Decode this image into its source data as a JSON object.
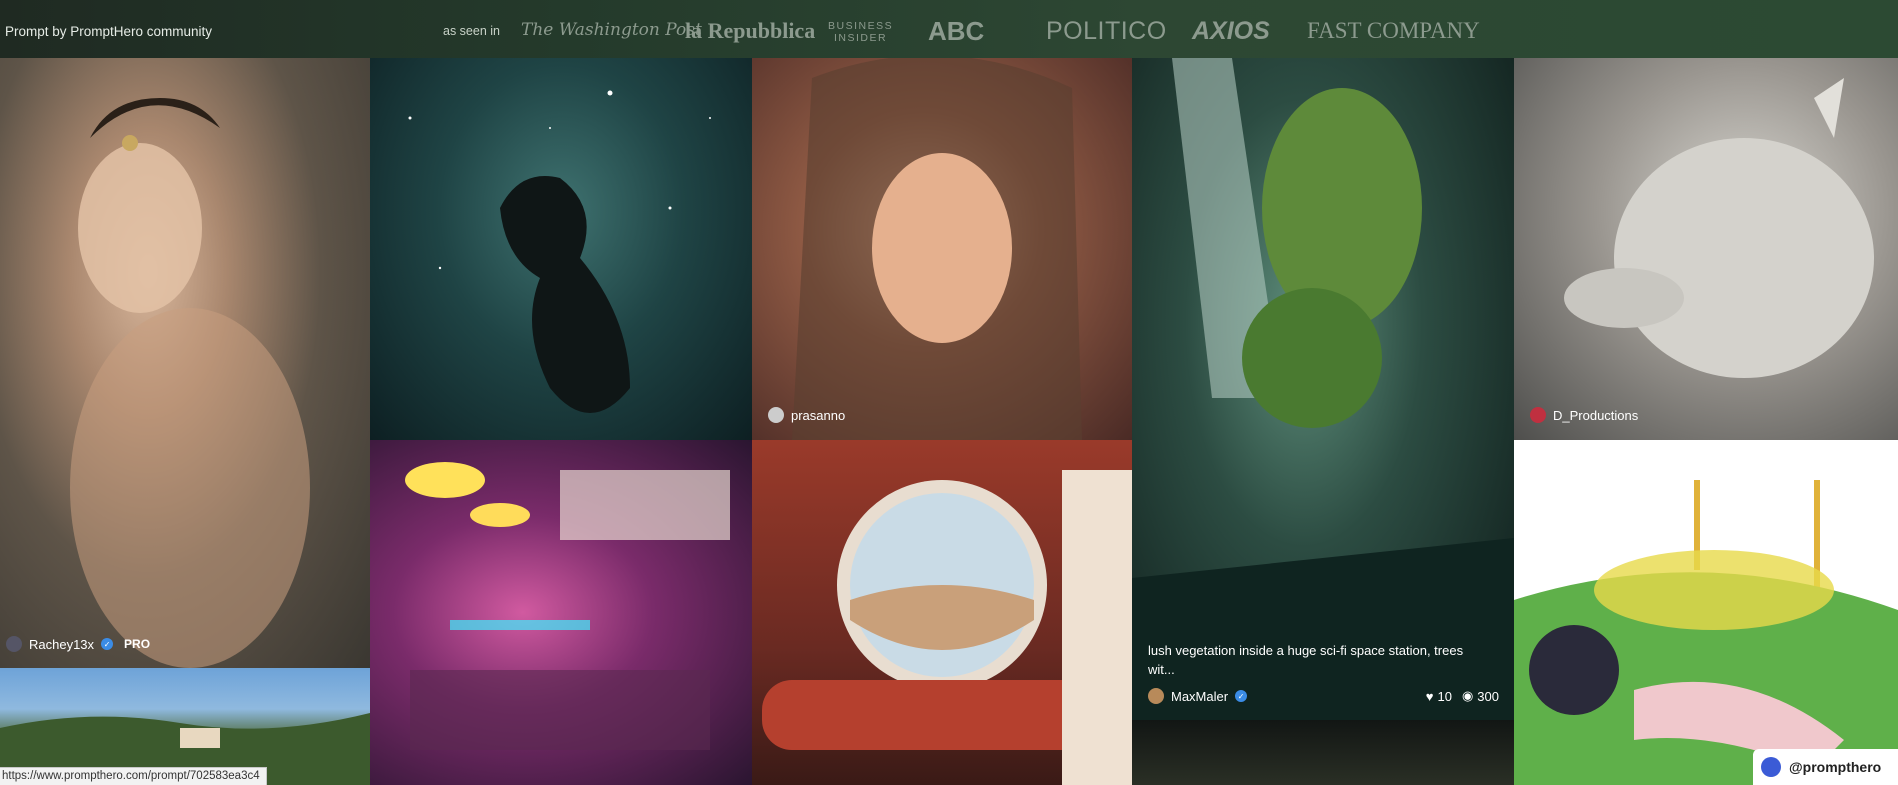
{
  "header": {
    "credit": "Prompt by PromptHero community",
    "as_seen_in": "as seen in",
    "logos": [
      "The Washington Post",
      "la Repubblica",
      "BUSINESS\nINSIDER",
      "ABC",
      "POLITICO",
      "AXIOS",
      "FAST COMPANY"
    ]
  },
  "tiles": {
    "t1": {
      "user": "Rachey13x",
      "badge": "PRO"
    },
    "t3": {
      "user": "prasanno"
    },
    "t4": {
      "prompt": "lush vegetation inside a huge sci-fi space station, trees wit...",
      "user": "MaxMaler",
      "likes": "10",
      "views": "300"
    },
    "t5": {
      "user": "D_Productions"
    }
  },
  "statusbar": {
    "url": "https://www.prompthero.com/prompt/702583ea3c4"
  },
  "corner": {
    "handle": "@prompthero"
  },
  "colors": {
    "topbar": "#2c4a33",
    "verified": "#3b8ce6"
  }
}
